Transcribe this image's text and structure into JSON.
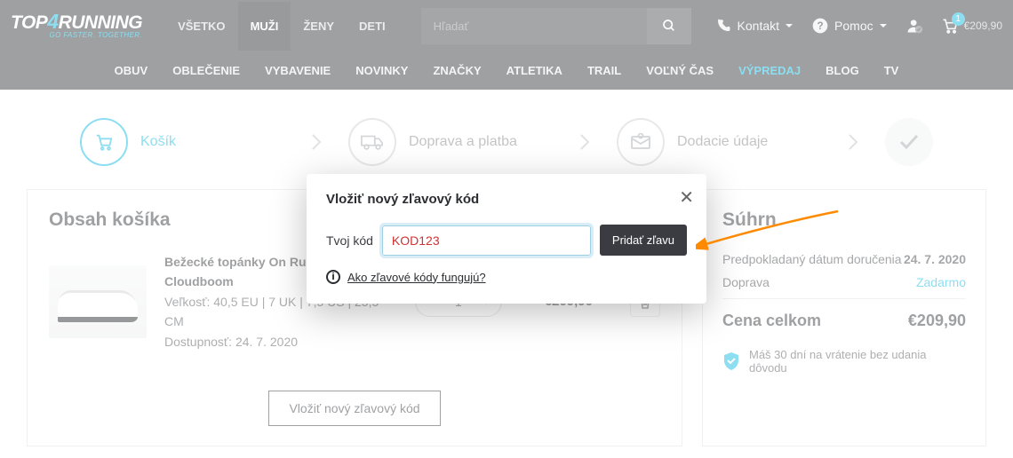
{
  "brand": {
    "part1": "TOP",
    "num": "4",
    "part2": "RUNNING",
    "tagline": "GO FASTER. TOGETHER."
  },
  "gender_tabs": [
    "VŠETKO",
    "MUŽI",
    "ŽENY",
    "DETI"
  ],
  "search": {
    "placeholder": "Hľadať"
  },
  "header": {
    "contact": "Kontakt",
    "help": "Pomoc",
    "cart_count": "1",
    "cart_price": "€209,90"
  },
  "nav": [
    "OBUV",
    "OBLEČENIE",
    "VYBAVENIE",
    "NOVINKY",
    "ZNAČKY",
    "ATLETIKA",
    "TRAIL",
    "VOĽNÝ ČAS",
    "VÝPREDAJ",
    "BLOG",
    "TV"
  ],
  "steps": {
    "s1": "Košík",
    "s2": "Doprava a platba",
    "s3": "Dodacie údaje"
  },
  "cart": {
    "title": "Obsah košíka",
    "product_name": "Bežecké topánky On Running Cloudboom",
    "size_line": "Veľkosť: 40,5 EU | 7 UK | 7,5 US | 25,5 CM",
    "avail_line": "Dostupnosť: 24. 7. 2020",
    "qty": "1",
    "line_price": "€209,90",
    "voucher_btn": "Vložiť nový zľavový kód"
  },
  "summary": {
    "title": "Súhrn",
    "delivery_label": "Predpokladaný dátum doručenia",
    "delivery_value": "24. 7. 2020",
    "shipping_label": "Doprava",
    "shipping_value": "Zadarmo",
    "total_label": "Cena celkom",
    "total_value": "€209,90",
    "guarantee": "Máš 30 dní na vrátenie bez udania dôvodu"
  },
  "modal": {
    "title": "Vložiť nový zľavový kód",
    "label": "Tvoj kód",
    "value": "KOD123",
    "submit": "Pridať zľavu",
    "help_link": "Ako zľavové kódy fungujú?"
  }
}
